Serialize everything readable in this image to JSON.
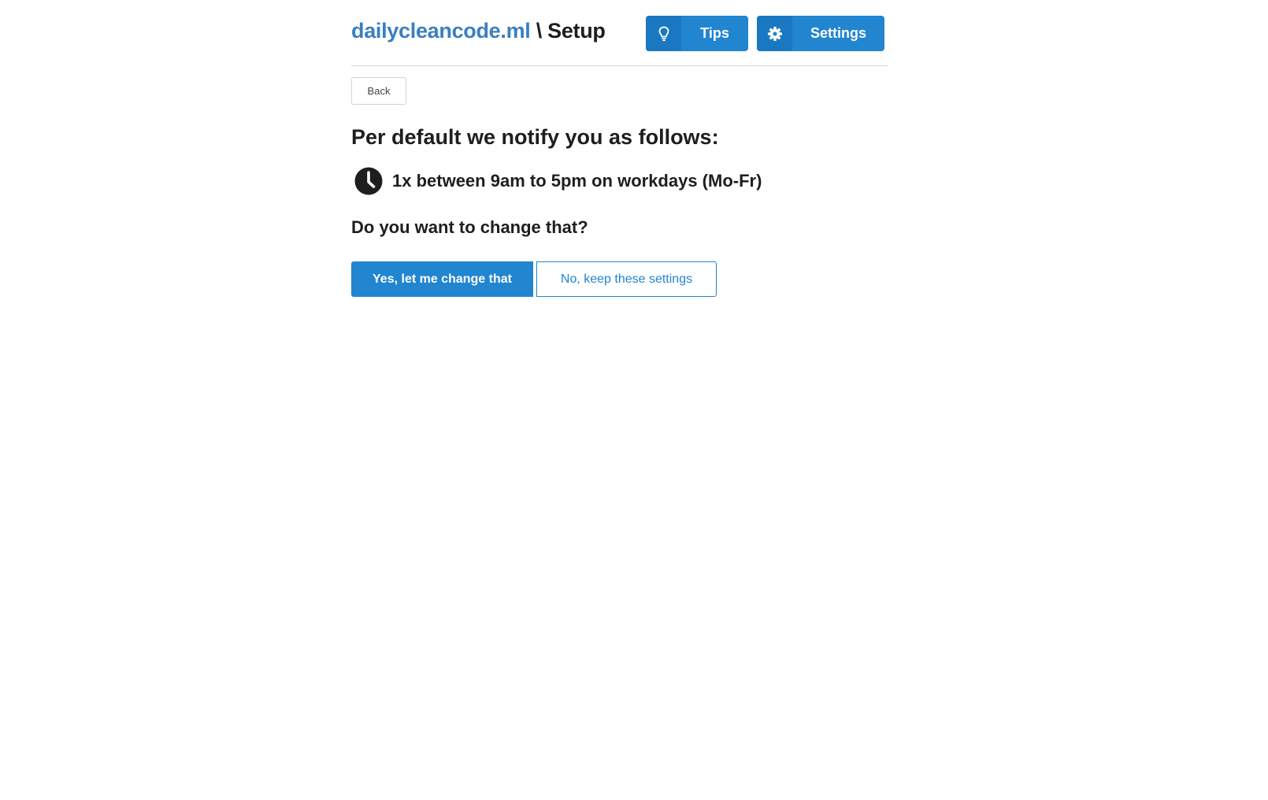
{
  "header": {
    "brand_link": "dailycleancode.ml",
    "brand_separator": " \\ ",
    "page_name": "Setup",
    "tips_label": "Tips",
    "tips_icon": "lightbulb-icon",
    "settings_label": "Settings",
    "settings_icon": "gear-icon"
  },
  "main": {
    "back_label": "Back",
    "heading": "Per default we notify you as follows:",
    "schedule_icon": "clock-icon",
    "schedule_text": "1x between 9am to 5pm on workdays (Mo-Fr)",
    "question": "Do you want to change that?",
    "yes_label": "Yes, let me change that",
    "no_label": "No, keep these settings"
  },
  "colors": {
    "primary": "#2185d0",
    "brand_link": "#3a7fc1",
    "text": "#1e1e1e",
    "divider": "#d4d4d5"
  }
}
